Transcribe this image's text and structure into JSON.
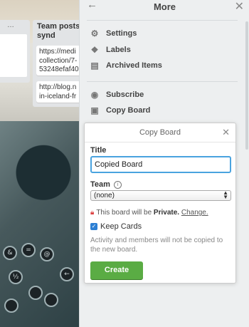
{
  "board": {
    "list_left_dots": "…",
    "list_right_title": "Team posts synd",
    "cards": [
      {
        "text": "https://medi collection/7‑ 53248efaf40"
      },
      {
        "text": "http://blog.n in-iceland-fr"
      }
    ],
    "keys": [
      {
        "label": "&"
      },
      {
        "label": "="
      },
      {
        "label": "@"
      },
      {
        "label": "←"
      },
      {
        "label": "½"
      },
      {
        "label": ""
      },
      {
        "label": ""
      },
      {
        "label": ""
      }
    ]
  },
  "sidebar": {
    "title": "More",
    "back_icon": "←",
    "close_icon": "✕",
    "items": [
      {
        "label": "Settings",
        "icon": "⚙"
      },
      {
        "label": "Labels",
        "icon": "❖"
      },
      {
        "label": "Archived Items",
        "icon": "▤"
      },
      {
        "label": "Subscribe",
        "icon": "◉"
      },
      {
        "label": "Copy Board",
        "icon": "▣"
      }
    ]
  },
  "popover": {
    "title": "Copy Board",
    "close_icon": "✕",
    "title_label": "Title",
    "title_value": "Copied Board",
    "team_label": "Team",
    "team_info_icon": "i",
    "team_selected": "(none)",
    "privacy_prefix": "This board will be",
    "privacy_value": "Private.",
    "privacy_link": "Change.",
    "keep_cards_label": "Keep Cards",
    "keep_cards_checked": true,
    "hint": "Activity and members will not be copied to the new board.",
    "create_label": "Create"
  },
  "colors": {
    "create_button": "#5aac44",
    "input_focus_border": "#4aa3df",
    "checkbox": "#2d7fd3",
    "lock_icon": "#dd4444",
    "sidebar_bg": "#edeff0"
  }
}
